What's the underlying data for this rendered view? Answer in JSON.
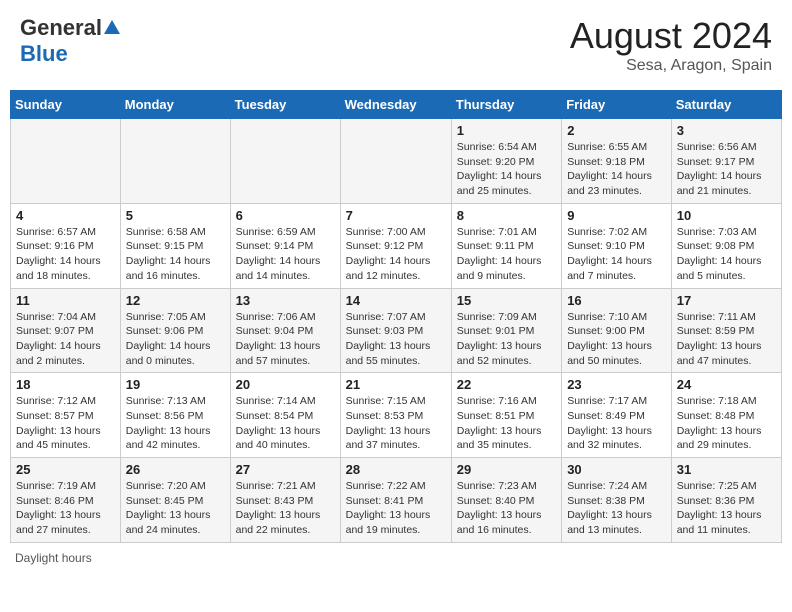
{
  "logo": {
    "general": "General",
    "blue": "Blue"
  },
  "title": "August 2024",
  "location": "Sesa, Aragon, Spain",
  "days_of_week": [
    "Sunday",
    "Monday",
    "Tuesday",
    "Wednesday",
    "Thursday",
    "Friday",
    "Saturday"
  ],
  "footer": "Daylight hours",
  "weeks": [
    [
      {
        "day": "",
        "detail": ""
      },
      {
        "day": "",
        "detail": ""
      },
      {
        "day": "",
        "detail": ""
      },
      {
        "day": "",
        "detail": ""
      },
      {
        "day": "1",
        "detail": "Sunrise: 6:54 AM\nSunset: 9:20 PM\nDaylight: 14 hours and 25 minutes."
      },
      {
        "day": "2",
        "detail": "Sunrise: 6:55 AM\nSunset: 9:18 PM\nDaylight: 14 hours and 23 minutes."
      },
      {
        "day": "3",
        "detail": "Sunrise: 6:56 AM\nSunset: 9:17 PM\nDaylight: 14 hours and 21 minutes."
      }
    ],
    [
      {
        "day": "4",
        "detail": "Sunrise: 6:57 AM\nSunset: 9:16 PM\nDaylight: 14 hours and 18 minutes."
      },
      {
        "day": "5",
        "detail": "Sunrise: 6:58 AM\nSunset: 9:15 PM\nDaylight: 14 hours and 16 minutes."
      },
      {
        "day": "6",
        "detail": "Sunrise: 6:59 AM\nSunset: 9:14 PM\nDaylight: 14 hours and 14 minutes."
      },
      {
        "day": "7",
        "detail": "Sunrise: 7:00 AM\nSunset: 9:12 PM\nDaylight: 14 hours and 12 minutes."
      },
      {
        "day": "8",
        "detail": "Sunrise: 7:01 AM\nSunset: 9:11 PM\nDaylight: 14 hours and 9 minutes."
      },
      {
        "day": "9",
        "detail": "Sunrise: 7:02 AM\nSunset: 9:10 PM\nDaylight: 14 hours and 7 minutes."
      },
      {
        "day": "10",
        "detail": "Sunrise: 7:03 AM\nSunset: 9:08 PM\nDaylight: 14 hours and 5 minutes."
      }
    ],
    [
      {
        "day": "11",
        "detail": "Sunrise: 7:04 AM\nSunset: 9:07 PM\nDaylight: 14 hours and 2 minutes."
      },
      {
        "day": "12",
        "detail": "Sunrise: 7:05 AM\nSunset: 9:06 PM\nDaylight: 14 hours and 0 minutes."
      },
      {
        "day": "13",
        "detail": "Sunrise: 7:06 AM\nSunset: 9:04 PM\nDaylight: 13 hours and 57 minutes."
      },
      {
        "day": "14",
        "detail": "Sunrise: 7:07 AM\nSunset: 9:03 PM\nDaylight: 13 hours and 55 minutes."
      },
      {
        "day": "15",
        "detail": "Sunrise: 7:09 AM\nSunset: 9:01 PM\nDaylight: 13 hours and 52 minutes."
      },
      {
        "day": "16",
        "detail": "Sunrise: 7:10 AM\nSunset: 9:00 PM\nDaylight: 13 hours and 50 minutes."
      },
      {
        "day": "17",
        "detail": "Sunrise: 7:11 AM\nSunset: 8:59 PM\nDaylight: 13 hours and 47 minutes."
      }
    ],
    [
      {
        "day": "18",
        "detail": "Sunrise: 7:12 AM\nSunset: 8:57 PM\nDaylight: 13 hours and 45 minutes."
      },
      {
        "day": "19",
        "detail": "Sunrise: 7:13 AM\nSunset: 8:56 PM\nDaylight: 13 hours and 42 minutes."
      },
      {
        "day": "20",
        "detail": "Sunrise: 7:14 AM\nSunset: 8:54 PM\nDaylight: 13 hours and 40 minutes."
      },
      {
        "day": "21",
        "detail": "Sunrise: 7:15 AM\nSunset: 8:53 PM\nDaylight: 13 hours and 37 minutes."
      },
      {
        "day": "22",
        "detail": "Sunrise: 7:16 AM\nSunset: 8:51 PM\nDaylight: 13 hours and 35 minutes."
      },
      {
        "day": "23",
        "detail": "Sunrise: 7:17 AM\nSunset: 8:49 PM\nDaylight: 13 hours and 32 minutes."
      },
      {
        "day": "24",
        "detail": "Sunrise: 7:18 AM\nSunset: 8:48 PM\nDaylight: 13 hours and 29 minutes."
      }
    ],
    [
      {
        "day": "25",
        "detail": "Sunrise: 7:19 AM\nSunset: 8:46 PM\nDaylight: 13 hours and 27 minutes."
      },
      {
        "day": "26",
        "detail": "Sunrise: 7:20 AM\nSunset: 8:45 PM\nDaylight: 13 hours and 24 minutes."
      },
      {
        "day": "27",
        "detail": "Sunrise: 7:21 AM\nSunset: 8:43 PM\nDaylight: 13 hours and 22 minutes."
      },
      {
        "day": "28",
        "detail": "Sunrise: 7:22 AM\nSunset: 8:41 PM\nDaylight: 13 hours and 19 minutes."
      },
      {
        "day": "29",
        "detail": "Sunrise: 7:23 AM\nSunset: 8:40 PM\nDaylight: 13 hours and 16 minutes."
      },
      {
        "day": "30",
        "detail": "Sunrise: 7:24 AM\nSunset: 8:38 PM\nDaylight: 13 hours and 13 minutes."
      },
      {
        "day": "31",
        "detail": "Sunrise: 7:25 AM\nSunset: 8:36 PM\nDaylight: 13 hours and 11 minutes."
      }
    ]
  ]
}
